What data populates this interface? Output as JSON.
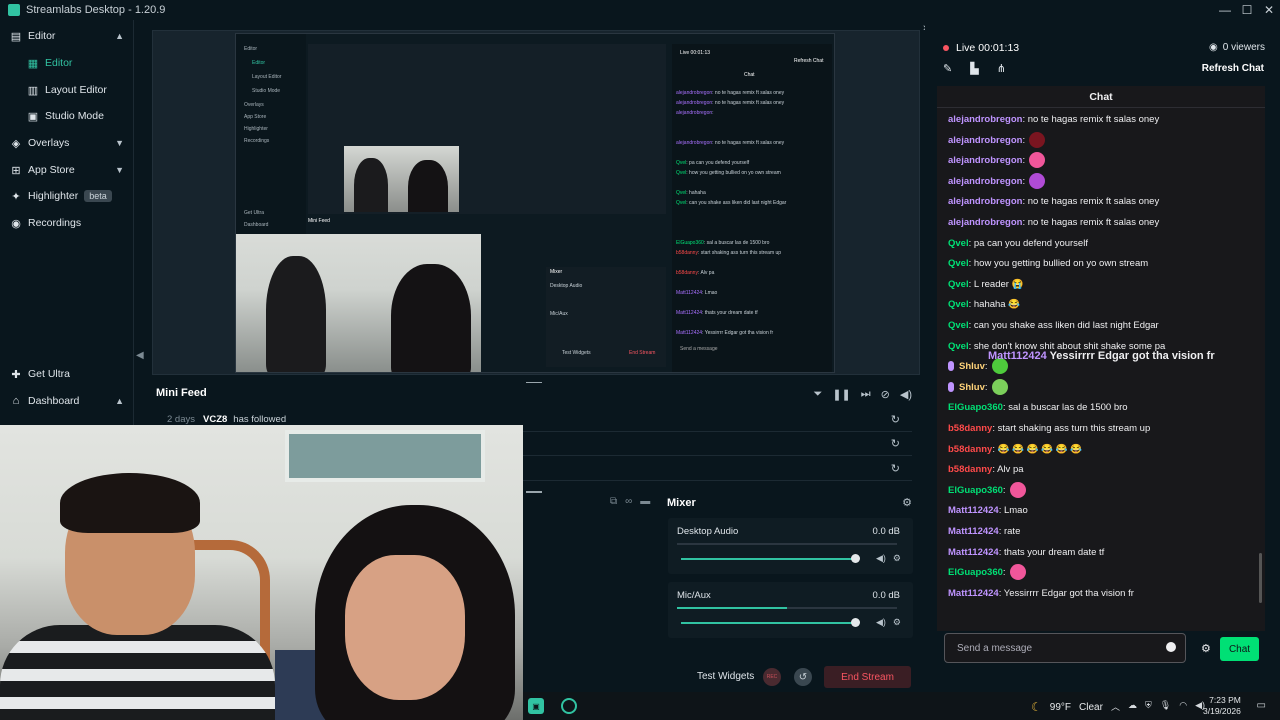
{
  "window": {
    "title": "Streamlabs Desktop - 1.20.9",
    "controls": [
      "—",
      "☐",
      "✕"
    ]
  },
  "sidebar": {
    "items": [
      {
        "label": "Editor",
        "icon": "editor-icon",
        "chevron": "up"
      },
      {
        "label": "Editor",
        "icon": "grid-icon",
        "active": true
      },
      {
        "label": "Layout Editor",
        "icon": "layout-icon"
      },
      {
        "label": "Studio Mode",
        "icon": "studio-mode-icon"
      },
      {
        "label": "Overlays",
        "icon": "overlays-icon",
        "chevron": "down"
      },
      {
        "label": "App Store",
        "icon": "store-icon",
        "chevron": "down"
      },
      {
        "label": "Highlighter",
        "icon": "highlighter-icon",
        "badge": "beta"
      },
      {
        "label": "Recordings",
        "icon": "recordings-icon"
      },
      {
        "label": "Get Ultra",
        "icon": "ultra-icon"
      },
      {
        "label": "Dashboard",
        "icon": "dashboard-icon",
        "chevron": "up"
      }
    ]
  },
  "nested_preview": {
    "sidebar": [
      "Editor",
      "Editor",
      "Layout Editor",
      "Studio Mode",
      "Overlays",
      "App Store",
      "Highlighter",
      "Recordings",
      "Get Ultra",
      "Dashboard"
    ],
    "mini_feed": "Mini Feed",
    "mixer": "Mixer",
    "desktop_audio": "Desktop Audio",
    "mic_aux": "Mic/Aux",
    "test_widgets": "Test Widgets",
    "end_stream": "End Stream",
    "chat_title": "Chat",
    "refresh_chat": "Refresh Chat",
    "live": "Live 00:01:13",
    "send_placeholder": "Send a message"
  },
  "mini_feed": {
    "title": "Mini Feed",
    "rows": [
      {
        "when": "2 days",
        "user": "VCZ8",
        "action": "has followed"
      },
      {
        "when": "",
        "user": "",
        "action": ""
      },
      {
        "when": "",
        "user": "",
        "action": ""
      }
    ]
  },
  "mixer": {
    "title": "Mixer",
    "channels": [
      {
        "name": "Desktop Audio",
        "db": "0.0 dB",
        "level": 0.0,
        "volume": 1.0
      },
      {
        "name": "Mic/Aux",
        "db": "0.0 dB",
        "level": 0.5,
        "volume": 1.0
      }
    ]
  },
  "footer": {
    "test_widgets": "Test Widgets",
    "rec_label": "REC",
    "end_stream": "End Stream"
  },
  "stream": {
    "status": "Live",
    "timer": "00:01:13",
    "viewers": "0 viewers",
    "refresh_chat": "Refresh Chat"
  },
  "chat": {
    "title": "Chat",
    "overlay": {
      "user": "Matt112424",
      "text": " Yessirrrr Edgar got tha vision fr"
    },
    "messages": [
      {
        "user": "alejandrobregon",
        "color": "#bf94ff",
        "text": ": no te hagas remix ft salas oney"
      },
      {
        "user": "alejandrobregon",
        "color": "#bf94ff",
        "text": ":",
        "emote": "#7a1520"
      },
      {
        "user": "alejandrobregon",
        "color": "#bf94ff",
        "text": ":",
        "emote": "#f0569a"
      },
      {
        "user": "alejandrobregon",
        "color": "#bf94ff",
        "text": ":",
        "emote": "#b04bd6"
      },
      {
        "user": "alejandrobregon",
        "color": "#bf94ff",
        "text": ": no te hagas remix ft salas oney"
      },
      {
        "user": "alejandrobregon",
        "color": "#bf94ff",
        "text": ": no te hagas remix ft salas oney"
      },
      {
        "user": "Qvel",
        "color": "#00e075",
        "text": ": pa can you defend yourself"
      },
      {
        "user": "Qvel",
        "color": "#00e075",
        "text": ": how you getting bullied on yo own stream"
      },
      {
        "user": "Qvel",
        "color": "#00e075",
        "text": ": L reader 😭"
      },
      {
        "user": "Qvel",
        "color": "#00e075",
        "text": ": hahaha 😂"
      },
      {
        "user": "Qvel",
        "color": "#00e075",
        "text": ": can you shake ass liken did last night Edgar"
      },
      {
        "user": "Qvel",
        "color": "#00e075",
        "text": ": she don't know shit about shit shake some pa"
      },
      {
        "user": "Shluv",
        "color": "#ffd37a",
        "text": ":",
        "emote": "#4ecb3c",
        "mic": true
      },
      {
        "user": "Shluv",
        "color": "#ffd37a",
        "text": ":",
        "emote": "#7ccf5b",
        "mic": true
      },
      {
        "user": "ElGuapo360",
        "color": "#00e075",
        "text": ": sal a buscar las de 1500 bro"
      },
      {
        "user": "b58danny",
        "color": "#ff4a4a",
        "text": ": start shaking ass turn this stream up"
      },
      {
        "user": "b58danny",
        "color": "#ff4a4a",
        "text": ": 😂 😂 😂 😂 😂 😂"
      },
      {
        "user": "b58danny",
        "color": "#ff4a4a",
        "text": ": Alv pa"
      },
      {
        "user": "ElGuapo360",
        "color": "#00e075",
        "text": ":",
        "emote": "#f0569a"
      },
      {
        "user": "Matt112424",
        "color": "#bf94ff",
        "text": ": Lmao"
      },
      {
        "user": "Matt112424",
        "color": "#bf94ff",
        "text": ": rate"
      },
      {
        "user": "Matt112424",
        "color": "#bf94ff",
        "text": ": thats your dream date tf"
      },
      {
        "user": "ElGuapo360",
        "color": "#00e075",
        "text": ":",
        "emote": "#f0569a"
      },
      {
        "user": "Matt112424",
        "color": "#bf94ff",
        "text": ": Yessirrrr Edgar got tha vision fr"
      }
    ],
    "input_placeholder": "Send a message",
    "send_label": "Chat"
  },
  "taskbar": {
    "weather_temp": "99°F",
    "weather_text": "Clear",
    "time": "7:23 PM",
    "date": "3/19/2026"
  },
  "colors": {
    "accent": "#31c3a2",
    "live_red": "#f85561",
    "chat_send": "#00e075"
  }
}
